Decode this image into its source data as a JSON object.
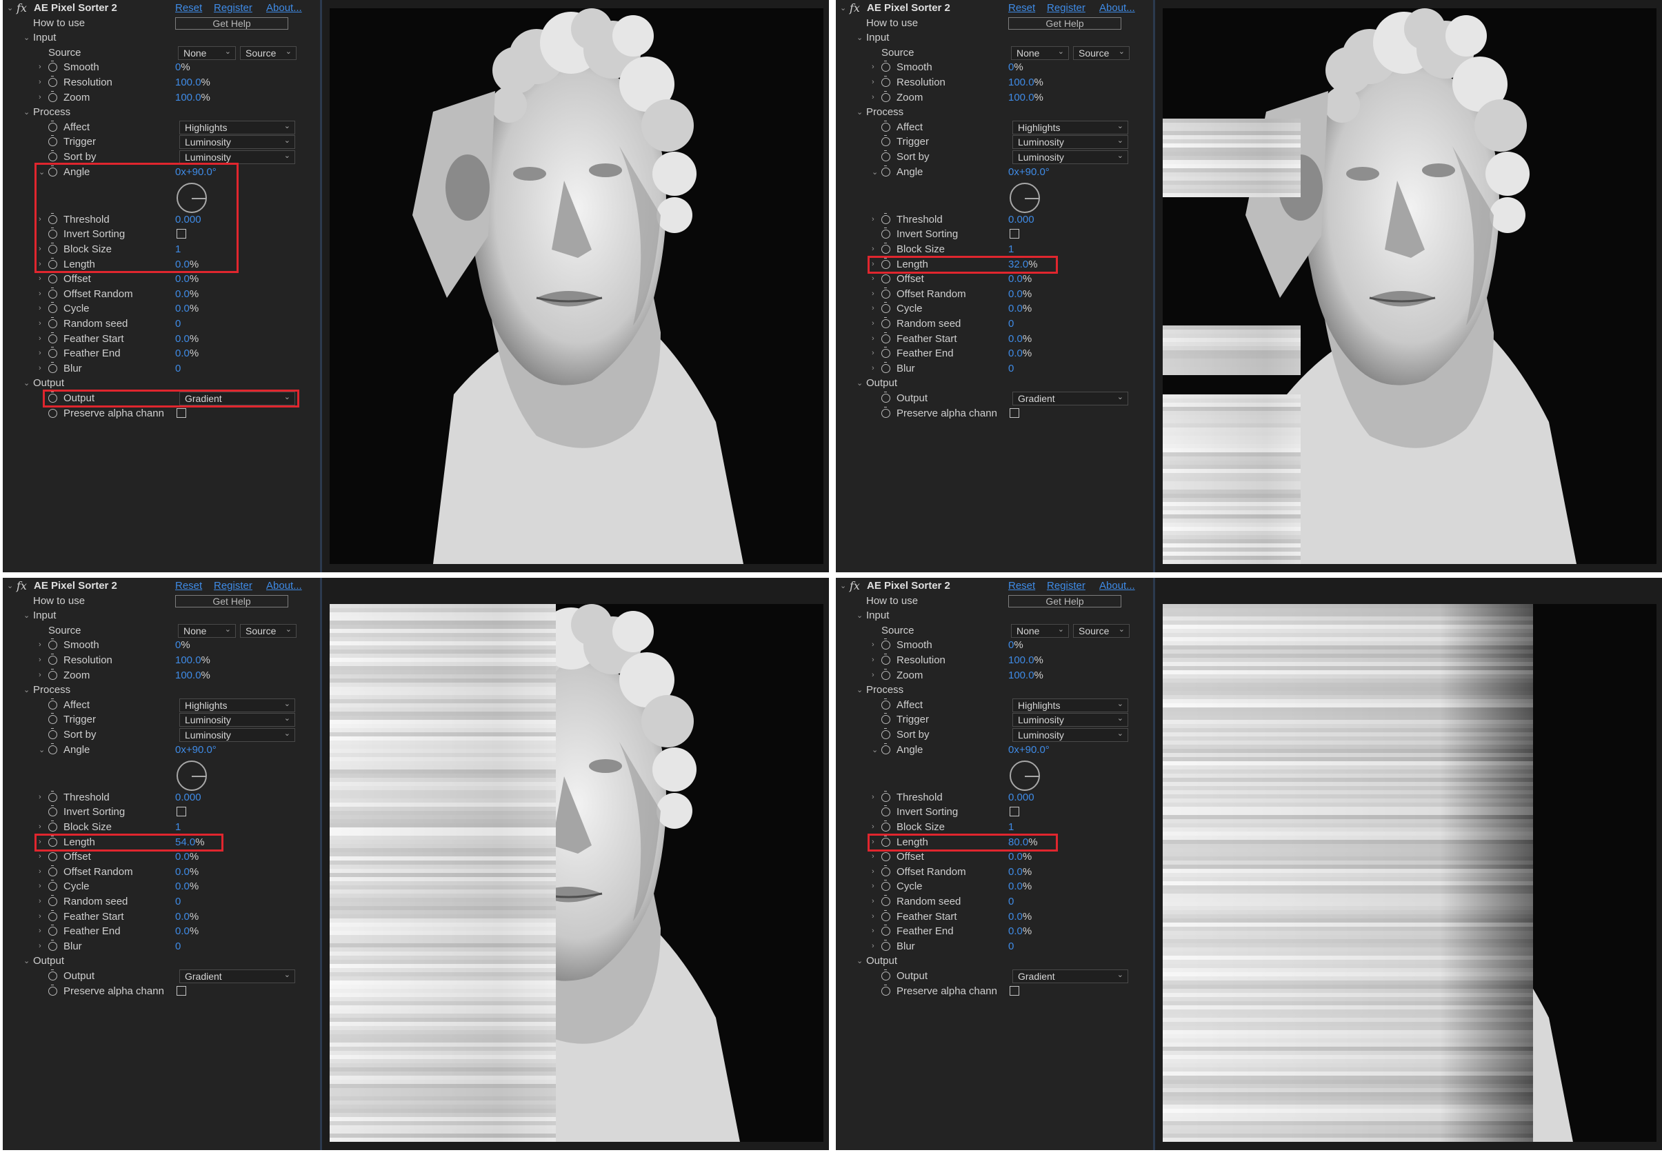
{
  "plugin": {
    "fx_symbol": "fx",
    "title": "AE Pixel Sorter 2",
    "links": {
      "reset": "Reset",
      "register": "Register",
      "about": "About..."
    },
    "how_to_use": "How to use",
    "get_help": "Get Help"
  },
  "groups": {
    "input": "Input",
    "process": "Process",
    "output": "Output"
  },
  "params": {
    "source": {
      "label": "Source",
      "value": "None",
      "layer": "Source"
    },
    "smooth": {
      "label": "Smooth",
      "value": "0",
      "unit": "%"
    },
    "resolution": {
      "label": "Resolution",
      "value": "100.0",
      "unit": "%"
    },
    "zoom": {
      "label": "Zoom",
      "value": "100.0",
      "unit": "%"
    },
    "affect": {
      "label": "Affect",
      "value": "Highlights"
    },
    "trigger": {
      "label": "Trigger",
      "value": "Luminosity"
    },
    "sort_by": {
      "label": "Sort by",
      "value": "Luminosity"
    },
    "angle": {
      "label": "Angle",
      "value": "0x+90.0°",
      "degrees": 90
    },
    "threshold": {
      "label": "Threshold",
      "value": "0.000"
    },
    "invert_sorting": {
      "label": "Invert Sorting",
      "checked": false
    },
    "block_size": {
      "label": "Block Size",
      "value": "1"
    },
    "length": {
      "label": "Length"
    },
    "offset": {
      "label": "Offset",
      "value": "0.0",
      "unit": "%"
    },
    "offset_random": {
      "label": "Offset Random",
      "value": "0.0",
      "unit": "%"
    },
    "cycle": {
      "label": "Cycle",
      "value": "0.0",
      "unit": "%"
    },
    "random_seed": {
      "label": "Random seed",
      "value": "0"
    },
    "feather_start": {
      "label": "Feather Start",
      "value": "0.0",
      "unit": "%"
    },
    "feather_end": {
      "label": "Feather End",
      "value": "0.0",
      "unit": "%"
    },
    "blur": {
      "label": "Blur",
      "value": "0"
    },
    "output": {
      "label": "Output",
      "value": "Gradient"
    },
    "preserve_alpha": {
      "label": "Preserve alpha chann",
      "checked": false
    }
  },
  "panels": [
    {
      "length_value": "0.0",
      "length_unit": "%",
      "length_fraction": 0.0
    },
    {
      "length_value": "32.0",
      "length_unit": "%",
      "length_fraction": 0.32
    },
    {
      "length_value": "54.0",
      "length_unit": "%",
      "length_fraction": 0.54
    },
    {
      "length_value": "80.0",
      "length_unit": "%",
      "length_fraction": 0.8
    }
  ],
  "colors": {
    "accent_blue": "#3f8be6",
    "highlight_red": "#e0262e",
    "panel_bg": "#232323",
    "viewer_bg": "#080808"
  }
}
